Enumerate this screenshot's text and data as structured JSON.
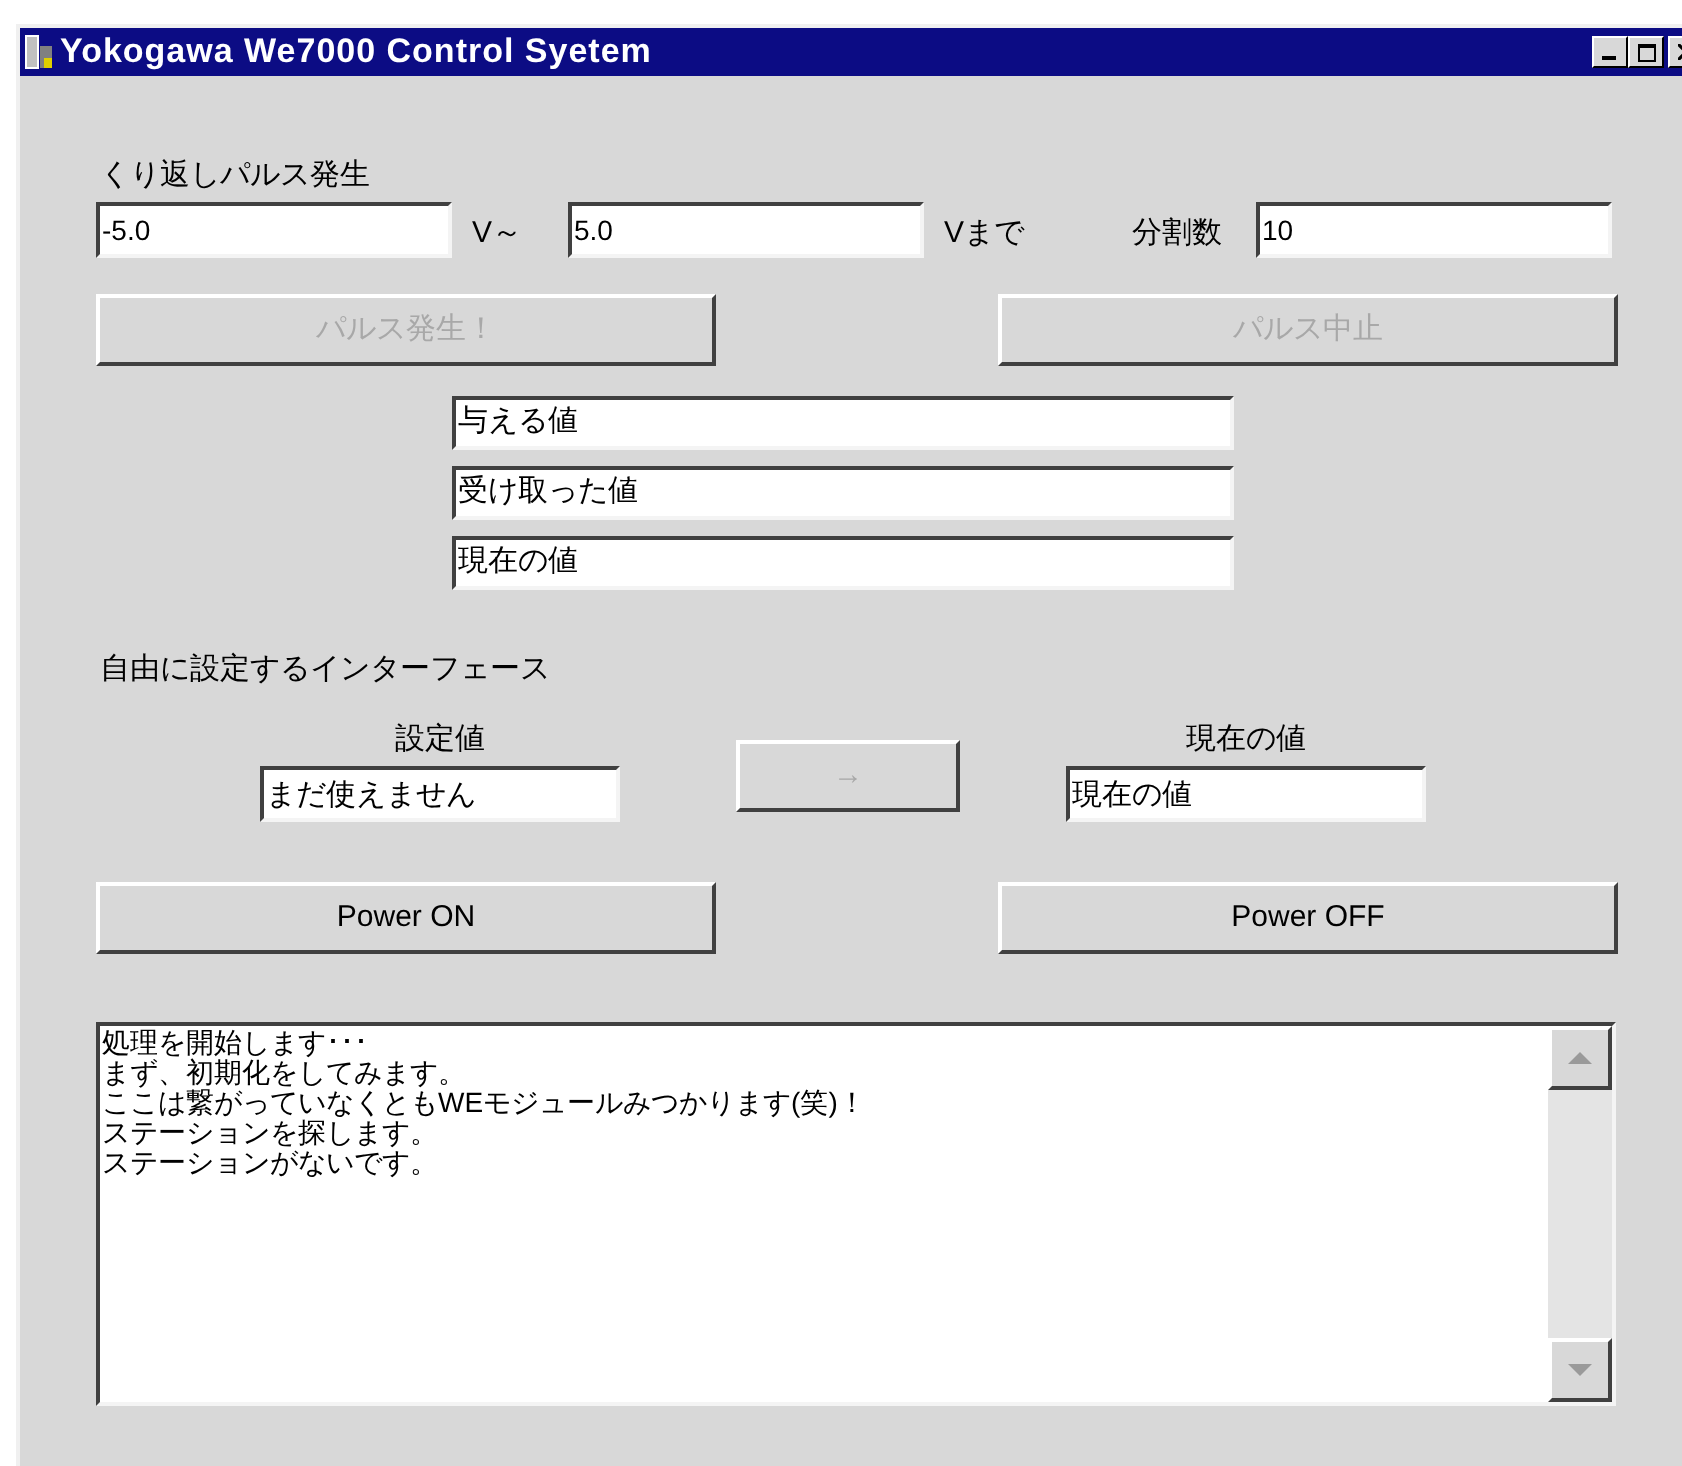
{
  "window": {
    "title": "Yokogawa We7000 Control Syetem"
  },
  "pulse": {
    "heading": "くり返しパルス発生",
    "from": "-5.0",
    "from_unit": "V～",
    "to": "5.0",
    "to_unit": "Vまで",
    "divisions_label": "分割数",
    "divisions": "10",
    "buttons": [
      {
        "label": "パルス発生！",
        "disabled": true
      },
      {
        "label": "パルス中止",
        "disabled": true
      }
    ],
    "readouts": [
      "与える値",
      "受け取った値",
      "現在の値"
    ]
  },
  "interface": {
    "heading": "自由に設定するインターフェース",
    "setting_label": "設定値",
    "setting_value": "まだ使えません",
    "arrow_button": {
      "label": "→",
      "disabled": true
    },
    "current_label": "現在の値",
    "current_value": "現在の値"
  },
  "power_buttons": [
    {
      "label": "Power ON",
      "disabled": false
    },
    {
      "label": "Power OFF",
      "disabled": false
    }
  ],
  "log": {
    "lines": [
      "処理を開始します･･･",
      "まず、初期化をしてみます。",
      "ここは繋がっていなくともWEモジュールみつかります(笑)！",
      "ステーションを探します。",
      "ステーションがないです。"
    ]
  }
}
